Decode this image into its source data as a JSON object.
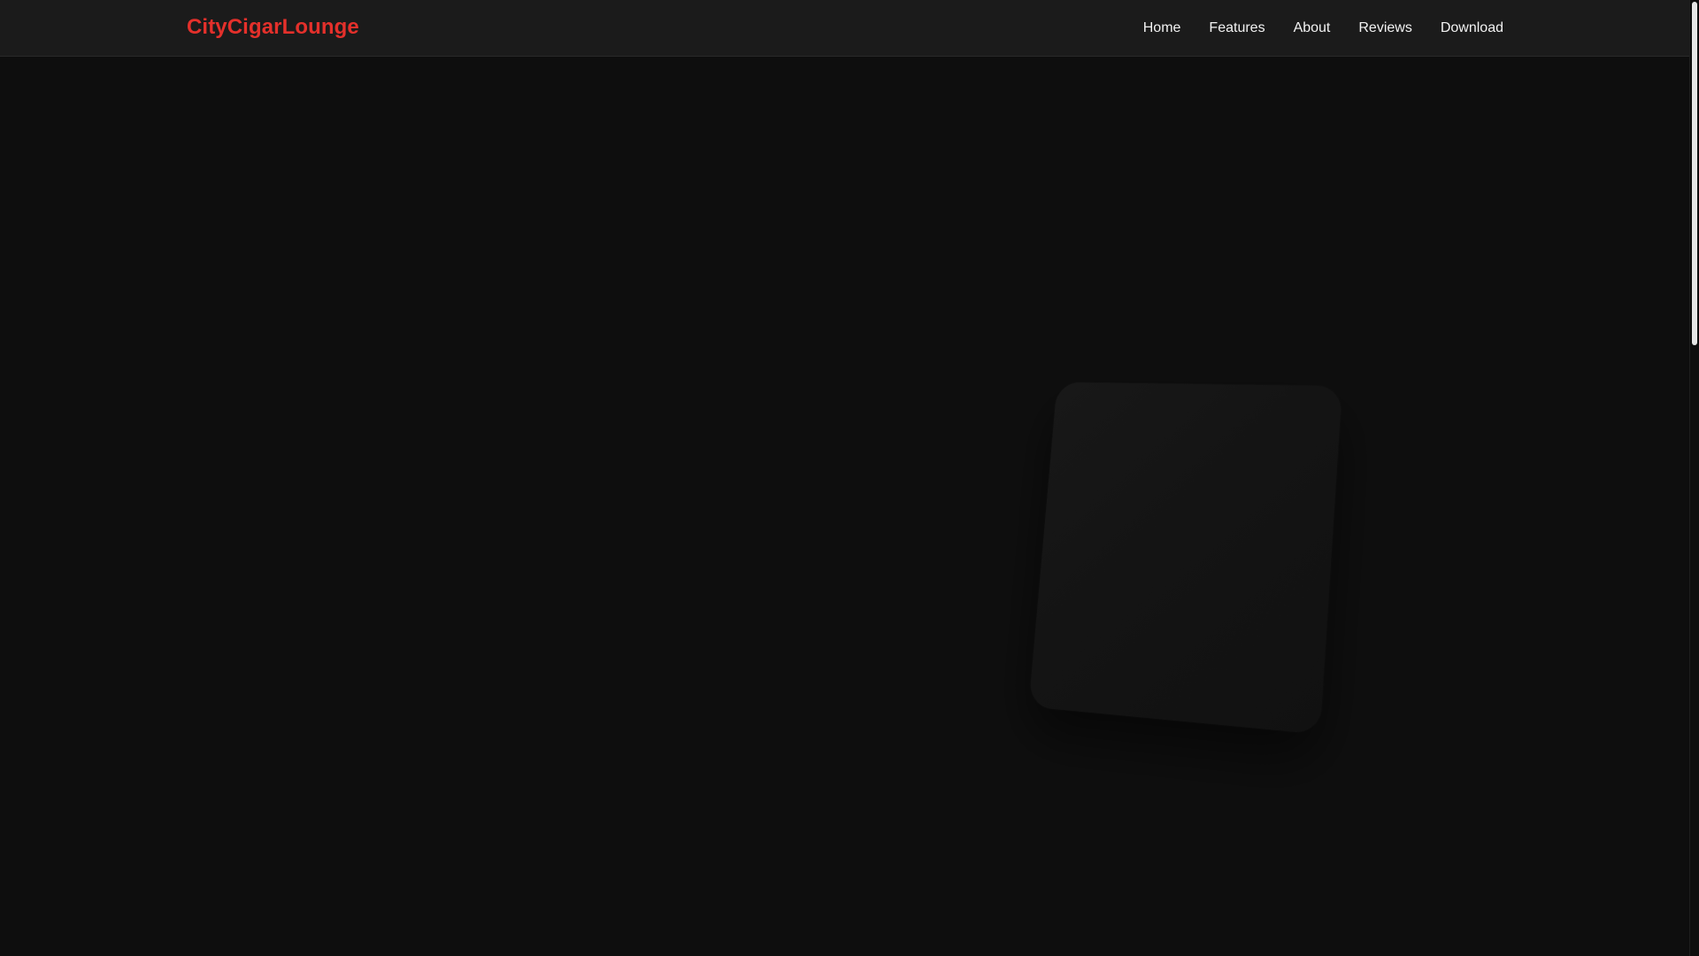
{
  "navbar": {
    "brand": "CityCigarLounge",
    "links": [
      {
        "label": "Home"
      },
      {
        "label": "Features"
      },
      {
        "label": "About"
      },
      {
        "label": "Reviews"
      },
      {
        "label": "Download"
      }
    ]
  },
  "colors": {
    "brand": "#e4302b",
    "background": "#0e0e0e",
    "navbar": "#1b1b1b",
    "nav_text": "#f2f2f2"
  }
}
